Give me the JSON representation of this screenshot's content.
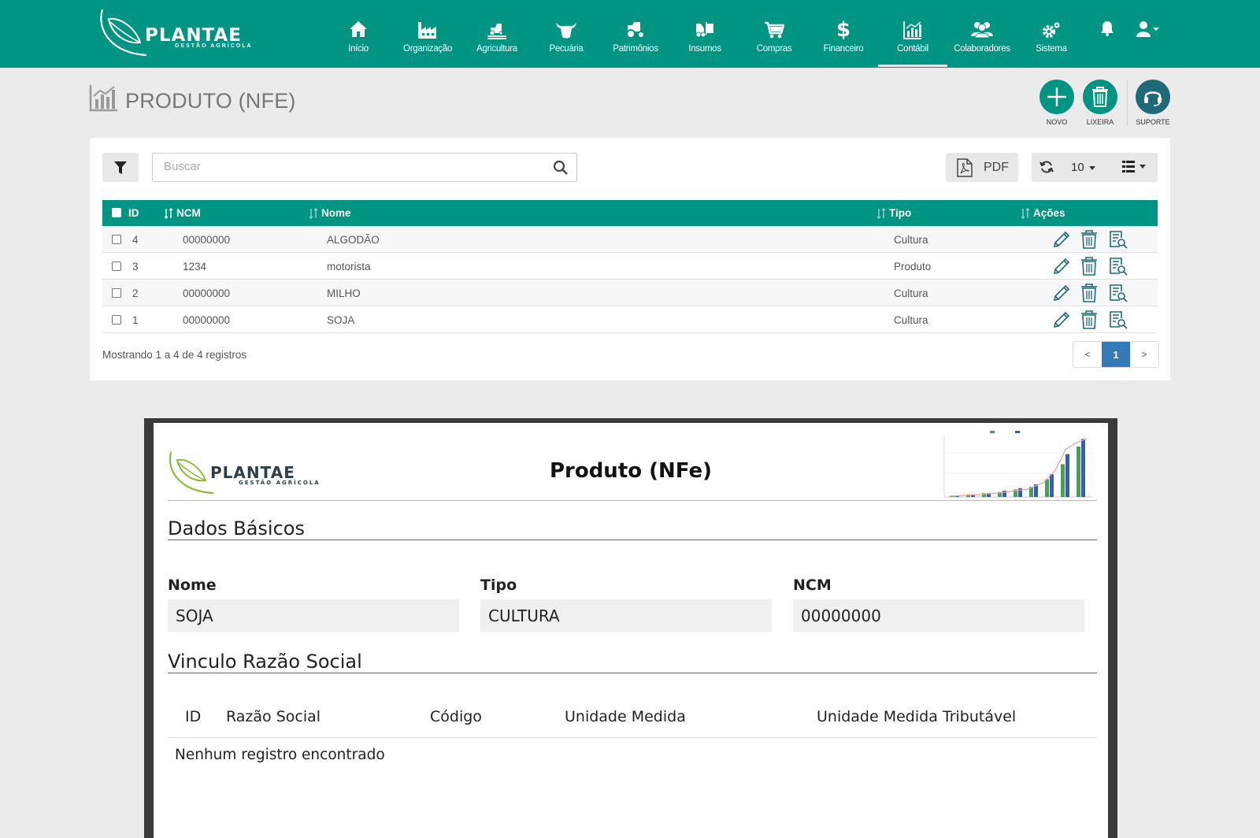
{
  "brand": {
    "name": "PLANTAE",
    "subtitle": "GESTÃO AGRÍCOLA"
  },
  "nav": {
    "items": [
      {
        "label": "Início",
        "icon": "home-icon"
      },
      {
        "label": "Organização",
        "icon": "factory-icon"
      },
      {
        "label": "Agricultura",
        "icon": "tractor-field-icon"
      },
      {
        "label": "Pecuária",
        "icon": "cow-icon"
      },
      {
        "label": "Patrimônios",
        "icon": "tractor-icon"
      },
      {
        "label": "Insumos",
        "icon": "forklift-icon"
      },
      {
        "label": "Compras",
        "icon": "cart-icon"
      },
      {
        "label": "Financeiro",
        "icon": "dollar-icon"
      },
      {
        "label": "Contábil",
        "icon": "chart-icon",
        "active": true
      },
      {
        "label": "Colaboradores",
        "icon": "users-icon"
      },
      {
        "label": "Sistema",
        "icon": "gear-icon"
      }
    ]
  },
  "page": {
    "title": "PRODUTO (NFE)",
    "actions": {
      "new": "NOVO",
      "trash": "LIXEIRA",
      "support": "SUPORTE"
    }
  },
  "toolbar": {
    "search_placeholder": "Buscar",
    "pdf_label": "PDF",
    "per_page": "10"
  },
  "table": {
    "columns": {
      "id": "ID",
      "ncm": "NCM",
      "name": "Nome",
      "type": "Tipo",
      "actions": "Ações"
    },
    "rows": [
      {
        "id": "4",
        "ncm": "00000000",
        "name": "ALGODÃO",
        "type": "Cultura"
      },
      {
        "id": "3",
        "ncm": "1234",
        "name": "motorista",
        "type": "Produto"
      },
      {
        "id": "2",
        "ncm": "00000000",
        "name": "MILHO",
        "type": "Cultura"
      },
      {
        "id": "1",
        "ncm": "00000000",
        "name": "SOJA",
        "type": "Cultura"
      }
    ],
    "footer": "Mostrando 1 a 4 de 4 registros",
    "pagination": {
      "prev": "<",
      "current": "1",
      "next": ">"
    }
  },
  "report": {
    "title": "Produto (NFe)",
    "section_basic": "Dados Básicos",
    "fields": {
      "name_label": "Nome",
      "name_value": "SOJA",
      "type_label": "Tipo",
      "type_value": "CULTURA",
      "ncm_label": "NCM",
      "ncm_value": "00000000"
    },
    "section_link": "Vinculo Razão Social",
    "link_columns": [
      "ID",
      "Razão Social",
      "Código",
      "Unidade Medida",
      "Unidade Medida Tributável"
    ],
    "empty_message": "Nenhum registro encontrado"
  },
  "colors": {
    "primary": "#009483",
    "support": "#1f6a78",
    "page_active": "#337ab7"
  }
}
